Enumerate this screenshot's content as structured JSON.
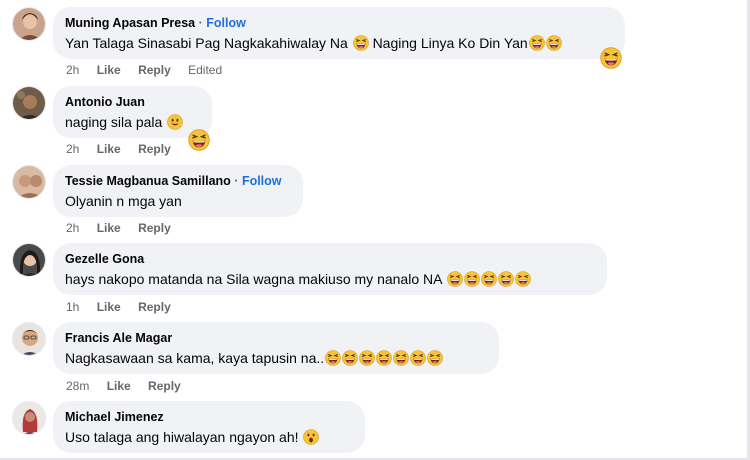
{
  "comments": [
    {
      "author": "Muning Apasan Presa",
      "follow": "Follow",
      "text_a": "Yan Talaga Sinasabi Pag Nagkakahiwalay Na",
      "text_b": "Naging Linya Ko Din Yan",
      "time": "2h",
      "like": "Like",
      "reply": "Reply",
      "edited": "Edited"
    },
    {
      "author": "Antonio Juan",
      "text": "naging sila pala",
      "time": "2h",
      "like": "Like",
      "reply": "Reply"
    },
    {
      "author": "Tessie Magbanua Samillano",
      "follow": "Follow",
      "text": "Olyanin n mga yan",
      "time": "2h",
      "like": "Like",
      "reply": "Reply"
    },
    {
      "author": "Gezelle Gona",
      "text": "hays nakopo matanda na Sila wagna makiuso my nanalo NA",
      "time": "1h",
      "like": "Like",
      "reply": "Reply"
    },
    {
      "author": "Francis Ale Magar",
      "text": "Nagkasawaan sa kama, kaya tapusin na..",
      "time": "28m",
      "like": "Like",
      "reply": "Reply"
    },
    {
      "author": "Michael Jimenez",
      "text": "Uso talaga ang hiwalayan ngayon ah!"
    }
  ],
  "colors": {
    "bubble": "#f0f2f5",
    "follow": "#216fdb",
    "meta": "#65676b"
  },
  "icons": [
    "laughing-emoji-icon",
    "smiling-emoji-icon",
    "open-mouth-emoji-icon"
  ]
}
